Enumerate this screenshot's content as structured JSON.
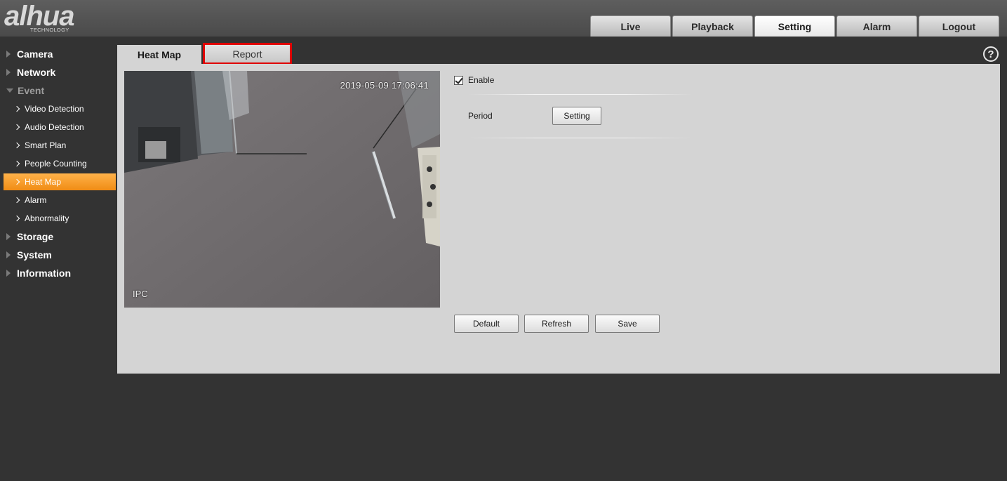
{
  "logo": {
    "main": "alhua",
    "sub": "TECHNOLOGY"
  },
  "nav": {
    "tabs": [
      {
        "label": "Live"
      },
      {
        "label": "Playback"
      },
      {
        "label": "Setting",
        "active": true
      },
      {
        "label": "Alarm"
      },
      {
        "label": "Logout"
      }
    ]
  },
  "sidebar": {
    "groups": [
      {
        "label": "Camera"
      },
      {
        "label": "Network"
      },
      {
        "label": "Event",
        "open": true
      },
      {
        "label": "Storage"
      },
      {
        "label": "System"
      },
      {
        "label": "Information"
      }
    ],
    "event_items": [
      {
        "label": "Video Detection"
      },
      {
        "label": "Audio Detection"
      },
      {
        "label": "Smart Plan"
      },
      {
        "label": "People Counting"
      },
      {
        "label": "Heat Map",
        "active": true
      },
      {
        "label": "Alarm"
      },
      {
        "label": "Abnormality"
      }
    ]
  },
  "subtabs": {
    "heat_map": "Heat Map",
    "report": "Report"
  },
  "help": {
    "symbol": "?"
  },
  "video": {
    "timestamp": "2019-05-09 17:06:41",
    "channel_name": "IPC"
  },
  "settings": {
    "enable_label": "Enable",
    "enable_checked": true,
    "period_label": "Period",
    "period_button": "Setting"
  },
  "actions": {
    "default": "Default",
    "refresh": "Refresh",
    "save": "Save"
  },
  "colors": {
    "background": "#333333",
    "panel": "#d4d4d4",
    "active_menu": "#f08c14",
    "report_highlight": "#e00000"
  }
}
